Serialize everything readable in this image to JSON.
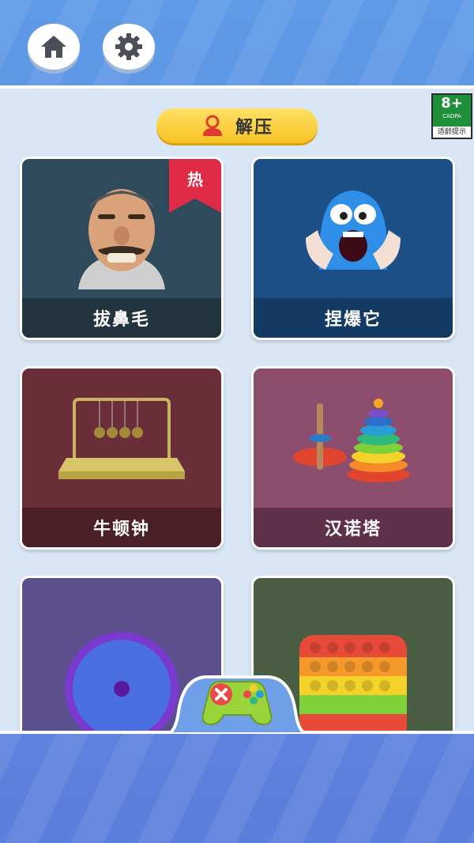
{
  "header": {
    "home_icon": "home-icon",
    "settings_icon": "gear-icon"
  },
  "section": {
    "title": "解压",
    "icon": "user-icon"
  },
  "age_badge": {
    "age": "8+",
    "org": "CADPA",
    "tip": "适龄提示"
  },
  "cards": [
    {
      "name": "拔鼻毛",
      "badge": "热",
      "color": "#2f4a5a",
      "bar": "#22343d",
      "art": "angry-man-face"
    },
    {
      "name": "捏爆它",
      "color": "#1c4f85",
      "bar": "#123a63",
      "art": "blue-squishy-monster"
    },
    {
      "name": "牛顿钟",
      "color": "#6a2e39",
      "bar": "#4a1f28",
      "art": "newtons-cradle"
    },
    {
      "name": "汉诺塔",
      "color": "#8d4e6d",
      "bar": "#5f3049",
      "art": "stacking-rings-toy"
    },
    {
      "name": "",
      "color": "#5b4f8d",
      "bar": "#473c73",
      "art": "spinner-wheel"
    },
    {
      "name": "",
      "color": "#4a5e44",
      "bar": "#3a4b35",
      "art": "pop-it-toy"
    }
  ],
  "bottom_nav": {
    "icon": "gamepad-icon"
  },
  "colors": {
    "accent_yellow": "#f7c324",
    "hot_red": "#e02a46",
    "panel": "#d8e6f6"
  }
}
